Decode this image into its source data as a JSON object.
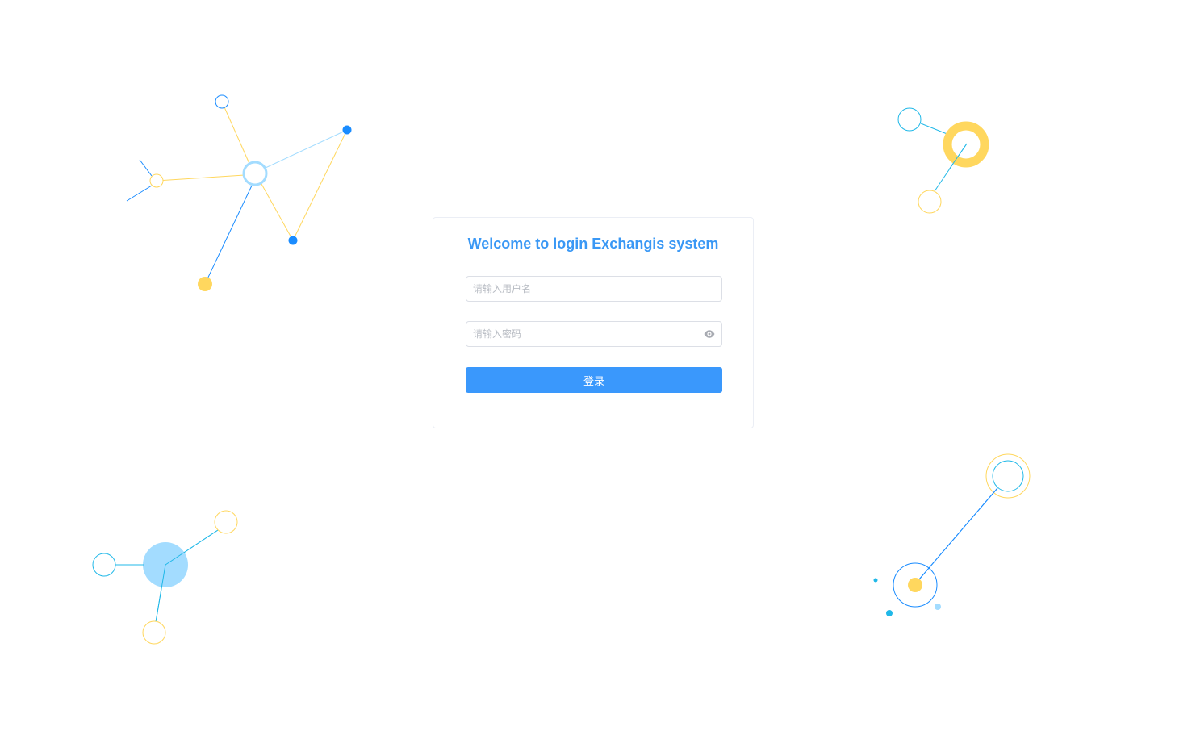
{
  "login": {
    "title": "Welcome to login Exchangis system",
    "username_placeholder": "请输入用户名",
    "password_placeholder": "请输入密码",
    "login_label": "登录"
  },
  "icons": {
    "password_toggle": "eye-icon"
  },
  "colors": {
    "accent": "#3a98fc",
    "title": "#3a98f5",
    "decor_blue": "#1a8cff",
    "decor_cyan": "#20b8e8",
    "decor_light_blue": "#a3dcff",
    "decor_yellow": "#ffd75e"
  }
}
